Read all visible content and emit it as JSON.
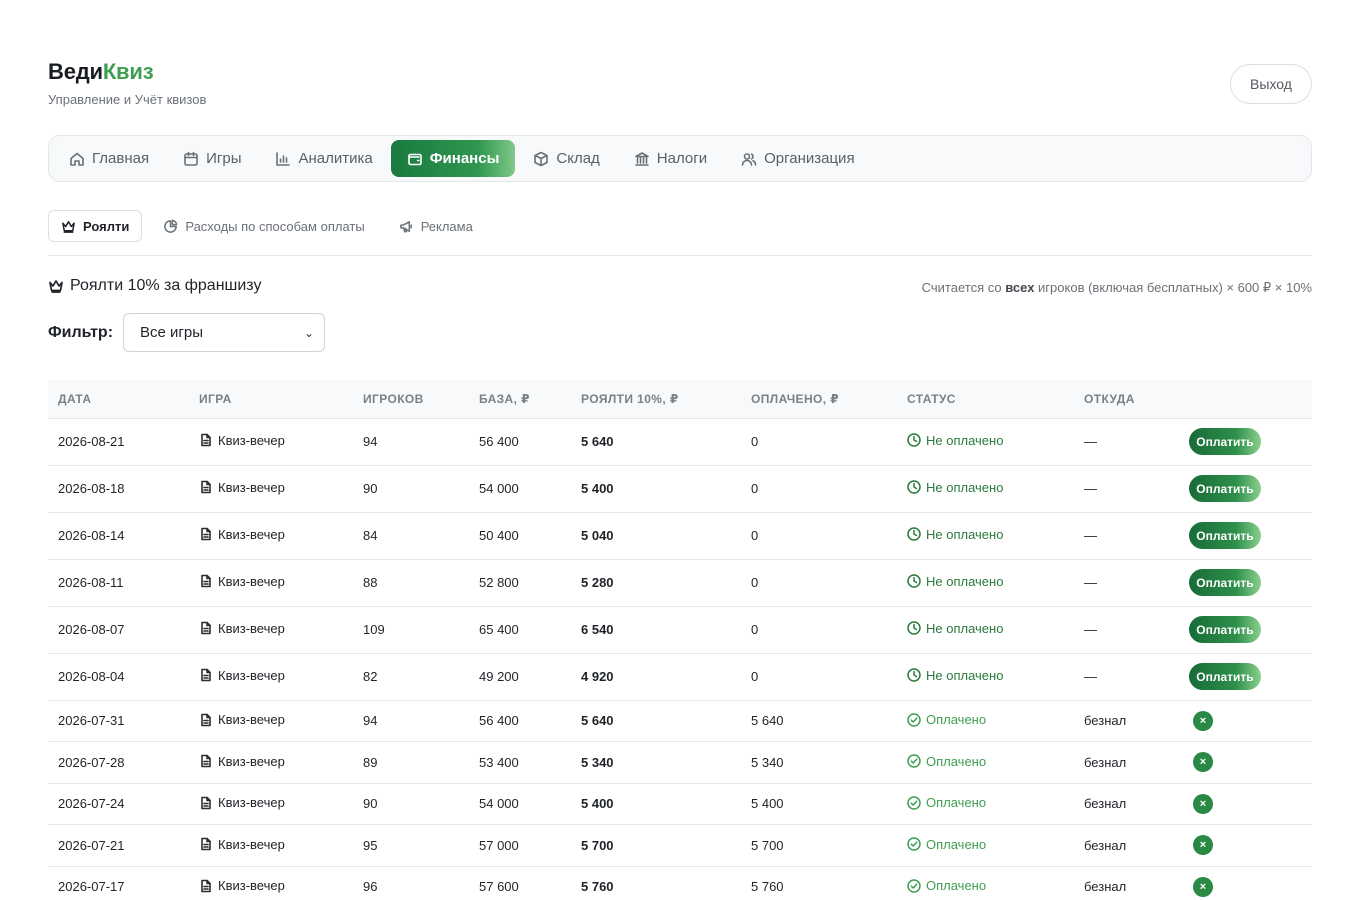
{
  "brand": {
    "name_main": "Веди",
    "name_accent": "Квиз",
    "subtitle": "Управление и Учёт квизов"
  },
  "header": {
    "logout_label": "Выход"
  },
  "nav": {
    "items": [
      {
        "label": "Главная",
        "icon": "home-icon"
      },
      {
        "label": "Игры",
        "icon": "calendar-icon"
      },
      {
        "label": "Аналитика",
        "icon": "bar-chart-icon"
      },
      {
        "label": "Финансы",
        "icon": "wallet-icon",
        "active": true
      },
      {
        "label": "Склад",
        "icon": "box-icon"
      },
      {
        "label": "Налоги",
        "icon": "bank-icon"
      },
      {
        "label": "Организация",
        "icon": "users-icon"
      }
    ]
  },
  "subtabs": {
    "items": [
      {
        "label": "Роялти",
        "icon": "crown-icon",
        "active": true
      },
      {
        "label": "Расходы по способам оплаты",
        "icon": "pie-chart-icon"
      },
      {
        "label": "Реклама",
        "icon": "megaphone-icon"
      }
    ]
  },
  "section": {
    "title": "Роялти 10% за франшизу",
    "note_prefix": "Считается со",
    "note_bold": "всех",
    "note_suffix": "игроков (включая бесплатных) × 600 ₽ × 10%"
  },
  "filter": {
    "label": "Фильтр:",
    "selected": "Все игры"
  },
  "table": {
    "headers": [
      "ДАТА",
      "ИГРА",
      "ИГРОКОВ",
      "БАЗА, ₽",
      "РОЯЛТИ 10%, ₽",
      "ОПЛАЧЕНО, ₽",
      "СТАТУС",
      "ОТКУДА",
      ""
    ],
    "pay_label": "Оплатить",
    "undo_label": "×",
    "rows": [
      {
        "date": "2026-08-21",
        "game": "Квиз-вечер",
        "players": "94",
        "base": "56 400",
        "royalty": "5 640",
        "paid": "0",
        "status": "Не оплачено",
        "source": "—",
        "is_paid": false
      },
      {
        "date": "2026-08-18",
        "game": "Квиз-вечер",
        "players": "90",
        "base": "54 000",
        "royalty": "5 400",
        "paid": "0",
        "status": "Не оплачено",
        "source": "—",
        "is_paid": false
      },
      {
        "date": "2026-08-14",
        "game": "Квиз-вечер",
        "players": "84",
        "base": "50 400",
        "royalty": "5 040",
        "paid": "0",
        "status": "Не оплачено",
        "source": "—",
        "is_paid": false
      },
      {
        "date": "2026-08-11",
        "game": "Квиз-вечер",
        "players": "88",
        "base": "52 800",
        "royalty": "5 280",
        "paid": "0",
        "status": "Не оплачено",
        "source": "—",
        "is_paid": false
      },
      {
        "date": "2026-08-07",
        "game": "Квиз-вечер",
        "players": "109",
        "base": "65 400",
        "royalty": "6 540",
        "paid": "0",
        "status": "Не оплачено",
        "source": "—",
        "is_paid": false
      },
      {
        "date": "2026-08-04",
        "game": "Квиз-вечер",
        "players": "82",
        "base": "49 200",
        "royalty": "4 920",
        "paid": "0",
        "status": "Не оплачено",
        "source": "—",
        "is_paid": false
      },
      {
        "date": "2026-07-31",
        "game": "Квиз-вечер",
        "players": "94",
        "base": "56 400",
        "royalty": "5 640",
        "paid": "5 640",
        "status": "Оплачено",
        "source": "безнал",
        "is_paid": true
      },
      {
        "date": "2026-07-28",
        "game": "Квиз-вечер",
        "players": "89",
        "base": "53 400",
        "royalty": "5 340",
        "paid": "5 340",
        "status": "Оплачено",
        "source": "безнал",
        "is_paid": true
      },
      {
        "date": "2026-07-24",
        "game": "Квиз-вечер",
        "players": "90",
        "base": "54 000",
        "royalty": "5 400",
        "paid": "5 400",
        "status": "Оплачено",
        "source": "безнал",
        "is_paid": true
      },
      {
        "date": "2026-07-21",
        "game": "Квиз-вечер",
        "players": "95",
        "base": "57 000",
        "royalty": "5 700",
        "paid": "5 700",
        "status": "Оплачено",
        "source": "безнал",
        "is_paid": true
      },
      {
        "date": "2026-07-17",
        "game": "Квиз-вечер",
        "players": "96",
        "base": "57 600",
        "royalty": "5 760",
        "paid": "5 760",
        "status": "Оплачено",
        "source": "безнал",
        "is_paid": true
      }
    ]
  }
}
